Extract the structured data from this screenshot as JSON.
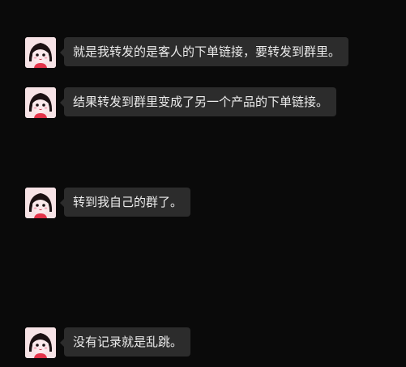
{
  "theme": {
    "background": "#0a0a0a",
    "bubble": "#2c2c2c",
    "text": "#ececec"
  },
  "messages": [
    {
      "avatar_icon": "cartoon-girl-avatar-icon",
      "text": "就是我转发的是客人的下单链接，要转发到群里。"
    },
    {
      "avatar_icon": "cartoon-girl-avatar-icon",
      "text": "结果转发到群里变成了另一个产品的下单链接。"
    },
    {
      "avatar_icon": "cartoon-girl-avatar-icon",
      "text": "转到我自己的群了。"
    },
    {
      "avatar_icon": "cartoon-girl-avatar-icon",
      "text": "没有记录就是乱跳。"
    }
  ]
}
